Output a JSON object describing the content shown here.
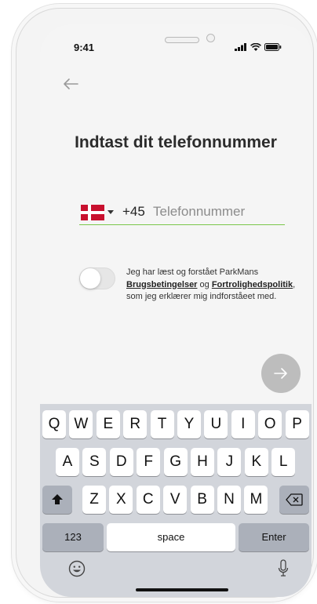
{
  "status_bar": {
    "time": "9:41"
  },
  "title": "Indtast dit telefonnummer",
  "phone": {
    "country_prefix": "+45",
    "placeholder": "Telefonnummer",
    "value": ""
  },
  "terms": {
    "text_before": "Jeg har læst og forstået ParkMans ",
    "link_terms": "Brugsbetingelser",
    "text_middle": " og ",
    "link_privacy": "Fortrolighedspolitik",
    "text_after": ", som jeg erklærer mig indforståeet med."
  },
  "keyboard": {
    "row1": [
      "Q",
      "W",
      "E",
      "R",
      "T",
      "Y",
      "U",
      "I",
      "O",
      "P"
    ],
    "row2": [
      "A",
      "S",
      "D",
      "F",
      "G",
      "H",
      "J",
      "K",
      "L"
    ],
    "row3": [
      "Z",
      "X",
      "C",
      "V",
      "B",
      "N",
      "M"
    ],
    "numbers_label": "123",
    "space_label": "space",
    "enter_label": "Enter"
  },
  "colors": {
    "accent_green": "#7ac64a",
    "next_button": "#bdbdbd",
    "flag_red": "#c8102e"
  },
  "icons": [
    "back-arrow-icon",
    "denmark-flag-icon",
    "chevron-down-icon",
    "arrow-right-icon",
    "shift-icon",
    "backspace-icon",
    "emoji-icon",
    "microphone-icon",
    "signal-icon",
    "wifi-icon",
    "battery-icon"
  ]
}
